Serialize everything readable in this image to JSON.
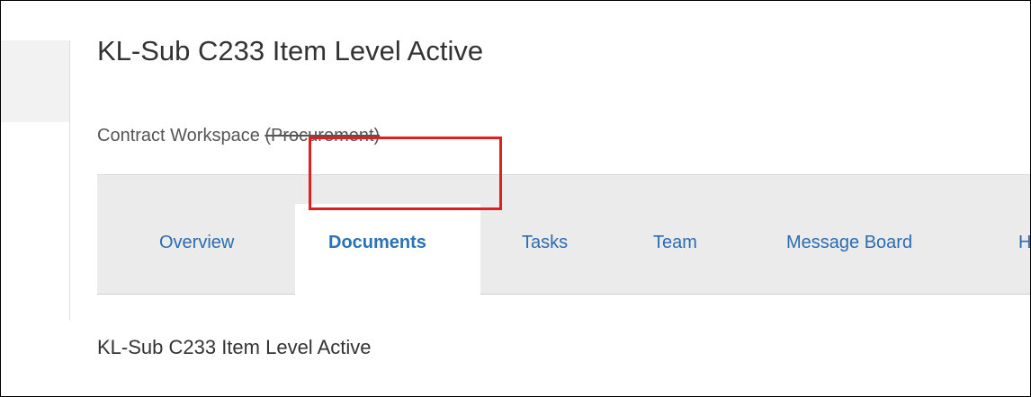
{
  "header": {
    "title": "KL-Sub C233 Item Level Active",
    "subtitle_prefix": "Contract Workspace ",
    "subtitle_strike": "(Procurement)"
  },
  "tabs": [
    {
      "label": "Overview",
      "active": false
    },
    {
      "label": "Documents",
      "active": true
    },
    {
      "label": "Tasks",
      "active": false
    },
    {
      "label": "Team",
      "active": false
    },
    {
      "label": "Message Board",
      "active": false
    },
    {
      "label": "H",
      "active": false
    }
  ],
  "content": {
    "section_title": "KL-Sub C233 Item Level Active"
  },
  "colors": {
    "tab_link": "#2b6cb0",
    "highlight": "#e02020"
  }
}
